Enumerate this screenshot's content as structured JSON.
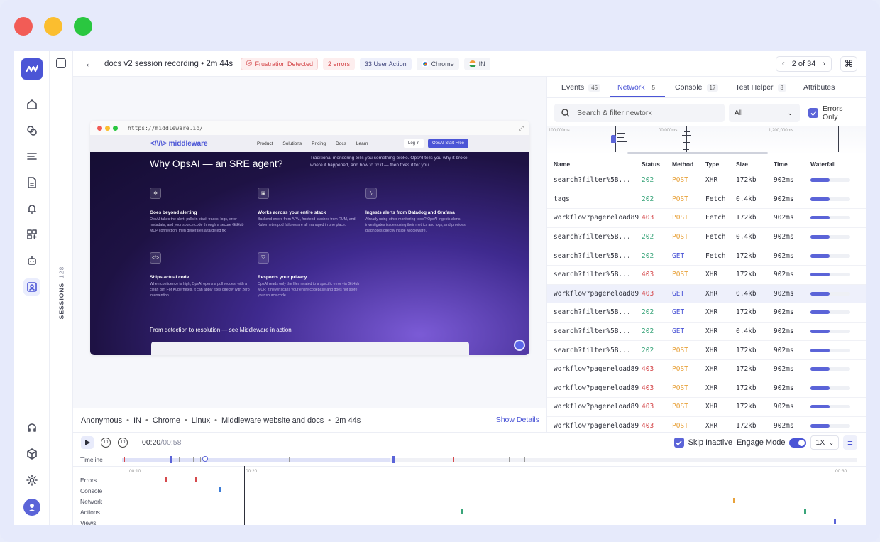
{
  "session": {
    "title": "docs v2 session recording • 2m 44s",
    "badges": {
      "frustration": "Frustration Detected",
      "errors": "2 errors",
      "user_action": "33 User Action",
      "browser": "Chrome",
      "country": "IN"
    },
    "pager": "2 of 34",
    "sessions_label": "SESSIONS",
    "sessions_count": "128"
  },
  "website": {
    "url": "https://middleware.io/",
    "logo": "middleware",
    "nav": [
      "Product",
      "Solutions",
      "Pricing",
      "Docs",
      "Learn"
    ],
    "login": "Log in",
    "cta": "OpsAI Start Free",
    "headline": "Why OpsAI — an SRE agent?",
    "sub": "Traditional monitoring tells you something broke. OpsAI tells you why it broke, where it happened, and how to fix it — then fixes it for you.",
    "features": [
      {
        "title": "Goes beyond alerting",
        "desc": "OpsAI takes the alert, pulls in stack traces, logs, error metadata, and your source code through a secure GitHub MCP connection, then generates a targeted fix."
      },
      {
        "title": "Works across your entire stack",
        "desc": "Backend errors from APM, frontend crashes from RUM, and Kubernetes pod failures are all managed in one place."
      },
      {
        "title": "Ingests alerts from Datadog and Grafana",
        "desc": "Already using other monitoring tools? OpsAI ingests alerts, investigates issues using their metrics and logs, and provides diagnoses directly inside Middleware."
      },
      {
        "title": "Ships actual code",
        "desc": "When confidence is high, OpsAI opens a pull request with a clean diff. For Kubernetes, it can apply fixes directly with zero intervention."
      },
      {
        "title": "Respects your privacy",
        "desc": "OpsAI reads only the files related to a specific error via GitHub MCP. It never scans your entire codebase and does not store your source code."
      }
    ],
    "bottom_cta": "From detection to resolution — see Middleware in action"
  },
  "info": {
    "user": "Anonymous",
    "country": "IN",
    "browser": "Chrome",
    "os": "Linux",
    "site": "Middleware website and docs",
    "duration": "2m 44s",
    "show_details": "Show Details"
  },
  "controls": {
    "current": "00:20",
    "total": "/00:58",
    "skip_inactive": "Skip Inactive",
    "engage_mode": "Engage Mode",
    "speed": "1X",
    "skip_back_label": "10",
    "skip_fwd_label": "10"
  },
  "timeline": {
    "rows": [
      "Timeline",
      "Errors",
      "Console",
      "Network",
      "Actions",
      "Views"
    ],
    "axis": [
      "00:10",
      "00:20",
      "00:30"
    ]
  },
  "panel": {
    "tabs": [
      {
        "label": "Events",
        "count": "45"
      },
      {
        "label": "Network",
        "count": "5"
      },
      {
        "label": "Console",
        "count": "17"
      },
      {
        "label": "Test Helper",
        "count": "8"
      },
      {
        "label": "Attributes",
        "count": ""
      }
    ],
    "search_placeholder": "Search & filter newtork",
    "filter_value": "All",
    "errors_only": "Errors Only",
    "wf_labels": [
      "100,000ms",
      "00,000ms",
      "1,200,000ms"
    ],
    "columns": [
      "Name",
      "Status",
      "Method",
      "Type",
      "Size",
      "Time",
      "Waterfall"
    ],
    "rows": [
      {
        "name": "search?filter%5B...",
        "status": "202",
        "method": "POST",
        "type": "XHR",
        "size": "172kb",
        "time": "902ms",
        "wf": 0.48
      },
      {
        "name": "tags",
        "status": "202",
        "method": "POST",
        "type": "Fetch",
        "size": "0.4kb",
        "time": "902ms",
        "wf": 0.48
      },
      {
        "name": "workflow?pagereload89",
        "status": "403",
        "method": "POST",
        "type": "Fetch",
        "size": "172kb",
        "time": "902ms",
        "wf": 0.48
      },
      {
        "name": "search?filter%5B...",
        "status": "202",
        "method": "POST",
        "type": "Fetch",
        "size": "0.4kb",
        "time": "902ms",
        "wf": 0.48
      },
      {
        "name": "search?filter%5B...",
        "status": "202",
        "method": "GET",
        "type": "Fetch",
        "size": "172kb",
        "time": "902ms",
        "wf": 0.48
      },
      {
        "name": "search?filter%5B...",
        "status": "403",
        "method": "POST",
        "type": "XHR",
        "size": "172kb",
        "time": "902ms",
        "wf": 0.48
      },
      {
        "name": "workflow?pagereload89",
        "status": "403",
        "method": "GET",
        "type": "XHR",
        "size": "0.4kb",
        "time": "902ms",
        "wf": 0.48
      },
      {
        "name": "search?filter%5B...",
        "status": "202",
        "method": "GET",
        "type": "XHR",
        "size": "172kb",
        "time": "902ms",
        "wf": 0.48
      },
      {
        "name": "search?filter%5B...",
        "status": "202",
        "method": "GET",
        "type": "XHR",
        "size": "0.4kb",
        "time": "902ms",
        "wf": 0.48
      },
      {
        "name": "search?filter%5B...",
        "status": "202",
        "method": "POST",
        "type": "XHR",
        "size": "172kb",
        "time": "902ms",
        "wf": 0.48
      },
      {
        "name": "workflow?pagereload89",
        "status": "403",
        "method": "POST",
        "type": "XHR",
        "size": "172kb",
        "time": "902ms",
        "wf": 0.48
      },
      {
        "name": "workflow?pagereload89",
        "status": "403",
        "method": "POST",
        "type": "XHR",
        "size": "172kb",
        "time": "902ms",
        "wf": 0.48
      },
      {
        "name": "workflow?pagereload89",
        "status": "403",
        "method": "POST",
        "type": "XHR",
        "size": "172kb",
        "time": "902ms",
        "wf": 0.48
      },
      {
        "name": "workflow?pagereload89",
        "status": "403",
        "method": "POST",
        "type": "XHR",
        "size": "172kb",
        "time": "902ms",
        "wf": 0.48
      }
    ]
  },
  "colors": {
    "accent": "#4b55d6",
    "status_ok": "#3aa57a",
    "status_err": "#d5494c",
    "method_post": "#e8a23b",
    "method_get": "#4b55d6"
  }
}
